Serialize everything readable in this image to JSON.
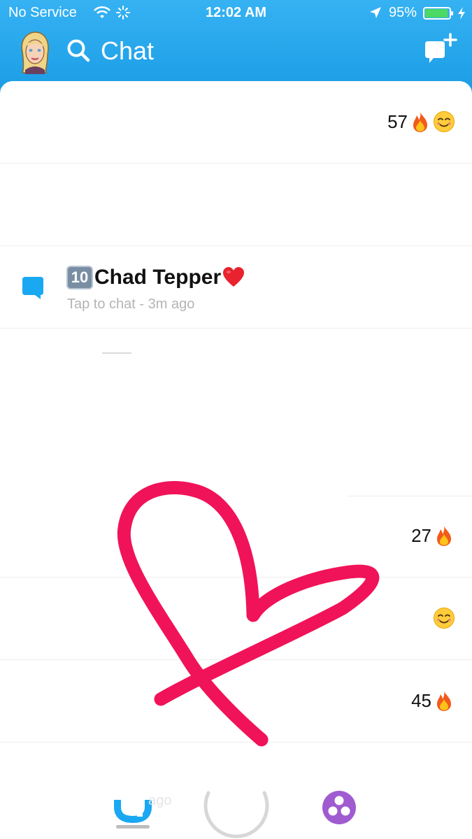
{
  "status_bar": {
    "carrier": "No Service",
    "time": "12:02 AM",
    "battery_percent": "95%",
    "battery_level": 0.95,
    "icons": [
      "wifi-icon",
      "activity-spinner-icon",
      "location-arrow-icon",
      "battery-icon",
      "charging-bolt-icon"
    ]
  },
  "header": {
    "title": "Chat",
    "icons": [
      "bitmoji-avatar",
      "search-icon",
      "new-chat-icon"
    ]
  },
  "chats": [
    {
      "name": "",
      "subtitle": "",
      "score": "57",
      "emojis": [
        "fire",
        "smile"
      ]
    },
    {
      "name": "",
      "subtitle": "",
      "score": "",
      "emojis": []
    },
    {
      "name": "Chad Tepper",
      "name_prefix_emoji": "10",
      "name_suffix_emoji": "heart",
      "subtitle": "Tap to chat - 3m ago",
      "score": "",
      "emojis": [],
      "icon": "chat-bubble-icon"
    },
    {
      "name": "",
      "subtitle": "",
      "score": "27",
      "emojis": [
        "fire"
      ]
    },
    {
      "name": "",
      "subtitle": "",
      "score": "",
      "emojis": [
        "smile"
      ]
    },
    {
      "name": "",
      "subtitle": "",
      "score": "45",
      "emojis": [
        "fire"
      ]
    }
  ],
  "bottom_nav": {
    "partial_text": "ago",
    "icons": [
      "chat-nav-icon",
      "capture-button",
      "discover-icon"
    ]
  },
  "colors": {
    "header_blue": "#2fa6ec",
    "chat_blue": "#1aa8f2",
    "doodle_pink": "#f0135a",
    "discover_purple": "#a05bd0"
  }
}
